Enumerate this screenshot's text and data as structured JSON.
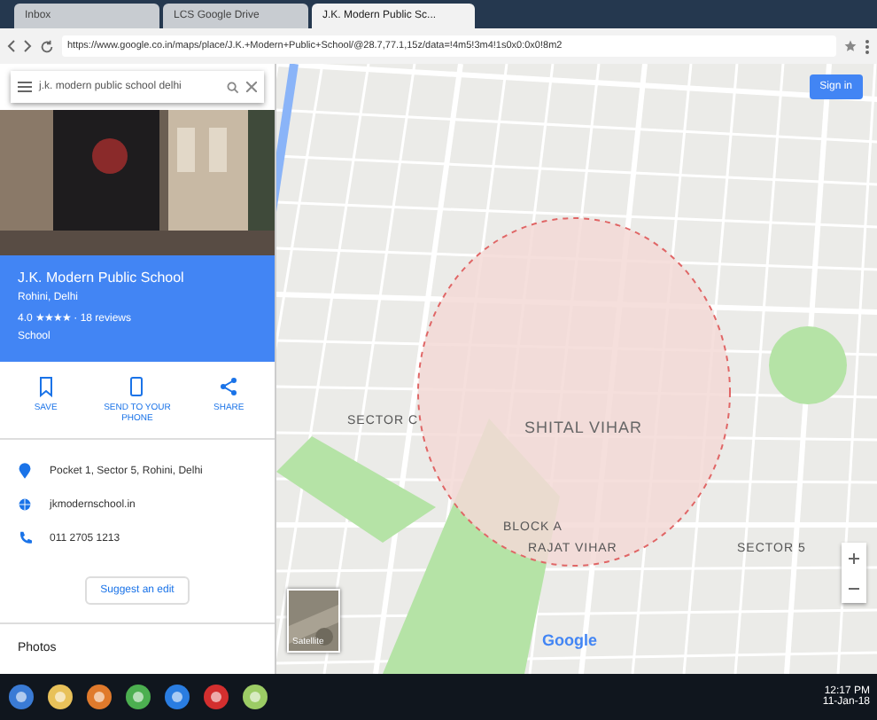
{
  "browser": {
    "tabs": [
      {
        "label": "Inbox",
        "selected": false
      },
      {
        "label": "LCS Google Drive",
        "selected": false
      },
      {
        "label": "J.K. Modern Public Sc...",
        "selected": true
      }
    ],
    "url": "https://www.google.co.in/maps/place/J.K.+Modern+Public+School/@28.7,77.1,15z/data=!4m5!3m4!1s0x0:0x0!8m2"
  },
  "sidebar": {
    "search": {
      "value": "j.k. modern public school delhi"
    },
    "place": {
      "name": "J.K. Modern Public School",
      "address_line": "Rohini, Delhi",
      "rating": "4.0 ★★★★ · 18 reviews",
      "category": "School"
    },
    "actions": [
      {
        "label": "SAVE"
      },
      {
        "label": "SEND TO YOUR PHONE"
      },
      {
        "label": "SHARE"
      }
    ],
    "info": [
      {
        "kind": "address",
        "text": "Pocket 1, Sector 5, Rohini, Delhi"
      },
      {
        "kind": "website",
        "text": "jkmodernschool.in"
      },
      {
        "kind": "phone",
        "text": "011 2705 1213"
      }
    ],
    "suggest_button": "Suggest an edit",
    "section": "Photos"
  },
  "map": {
    "sign_in": "Sign in",
    "labels": [
      "SECTOR C",
      "SHITAL VIHAR",
      "BLOCK A",
      "RAJAT VIHAR",
      "SECTOR 5"
    ],
    "logo": "Google",
    "satellite": "Satellite"
  },
  "taskbar": {
    "time": "12:17 PM",
    "date": "11-Jan-18"
  }
}
